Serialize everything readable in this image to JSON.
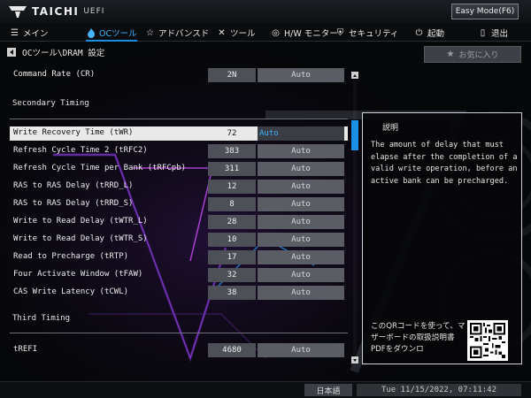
{
  "header": {
    "brand": "TAICHI",
    "sub": "UEFI",
    "easy_mode_label": "Easy Mode(F6)"
  },
  "menu": {
    "items": [
      {
        "label": "メイン",
        "icon": "list-icon"
      },
      {
        "label": "OCツール",
        "icon": "flame-icon"
      },
      {
        "label": "アドバンスド",
        "icon": "star-icon"
      },
      {
        "label": "ツール",
        "icon": "wrench-icon"
      },
      {
        "label": "H/W モニター",
        "icon": "monitor-icon"
      },
      {
        "label": "セキュリティ",
        "icon": "shield-icon"
      },
      {
        "label": "起動",
        "icon": "power-icon"
      },
      {
        "label": "退出",
        "icon": "exit-icon"
      }
    ],
    "active": "OCツール"
  },
  "breadcrumb": "OCツール\\DRAM 設定",
  "favorite_label": "お気に入り",
  "command_rate": {
    "label": "Command Rate (CR)",
    "value": "2N",
    "option": "Auto"
  },
  "sections": {
    "secondary": "Secondary Timing",
    "third": "Third Timing"
  },
  "secondary_rows": [
    {
      "label": "Write Recovery Time (tWR)",
      "value": "72",
      "option": "Auto"
    },
    {
      "label": "Refresh Cycle Time 2 (tRFC2)",
      "value": "383",
      "option": "Auto"
    },
    {
      "label": "Refresh Cycle Time per Bank (tRFCpb)",
      "value": "311",
      "option": "Auto"
    },
    {
      "label": "RAS to RAS Delay (tRRD_L)",
      "value": "12",
      "option": "Auto"
    },
    {
      "label": "RAS to RAS Delay (tRRD_S)",
      "value": "8",
      "option": "Auto"
    },
    {
      "label": "Write to Read Delay (tWTR_L)",
      "value": "28",
      "option": "Auto"
    },
    {
      "label": "Write to Read Delay (tWTR_S)",
      "value": "10",
      "option": "Auto"
    },
    {
      "label": "Read to Precharge (tRTP)",
      "value": "17",
      "option": "Auto"
    },
    {
      "label": "Four Activate Window (tFAW)",
      "value": "32",
      "option": "Auto"
    },
    {
      "label": "CAS Write Latency (tCWL)",
      "value": "38",
      "option": "Auto"
    }
  ],
  "trefi": {
    "label": "tREFI",
    "value": "4680",
    "option": "Auto"
  },
  "description": {
    "title": "説明",
    "text": "The amount of delay that must elapse after the completion of a valid write operation, before an active bank can be precharged.",
    "qr_text": "このQRコードを使って、マザーボードの取扱説明書PDFをダウンロ"
  },
  "footer": {
    "language": "日本語",
    "datetime": "Tue 11/15/2022, 07:11:42"
  },
  "colors": {
    "accent": "#1b8de0",
    "active_text": "#46b4ff"
  }
}
